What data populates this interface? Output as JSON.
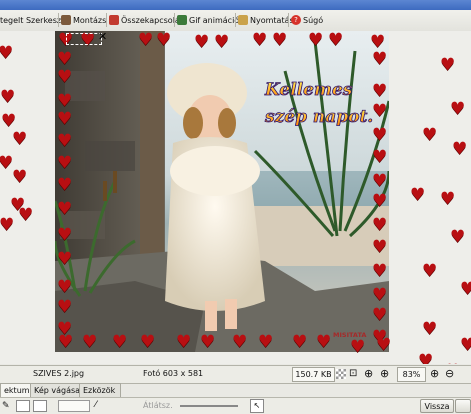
{
  "toolbar": {
    "items": [
      {
        "label": "tegelt Szerkesztő",
        "icon": "editor-icon"
      },
      {
        "label": "Montázs",
        "icon": "montage-icon"
      },
      {
        "label": "Összekapcsolás",
        "icon": "join-icon"
      },
      {
        "label": "Gif animáció",
        "icon": "gif-icon"
      },
      {
        "label": "Nyomtatás",
        "icon": "print-icon"
      },
      {
        "label": "Súgó",
        "icon": "help-icon"
      }
    ]
  },
  "image": {
    "text_line1": "Kellemes",
    "text_line2": "szép napot.",
    "watermark": "MISITATA"
  },
  "status": {
    "filename": "SZIVES 2.jpg",
    "photo_size": "Fotó 603 x 581",
    "file_size": "150.7 KB",
    "zoom": "83%"
  },
  "tabs": [
    {
      "label": "ektum"
    },
    {
      "label": "Kép vágása"
    },
    {
      "label": "Ezközök"
    }
  ],
  "tools": {
    "opacity_label": "Átlátsz.",
    "back_button": "Vissza"
  },
  "colors": {
    "heart": "#b80f12",
    "text_gradient": "#ffd200",
    "text_outline": "#2a0f6e"
  }
}
